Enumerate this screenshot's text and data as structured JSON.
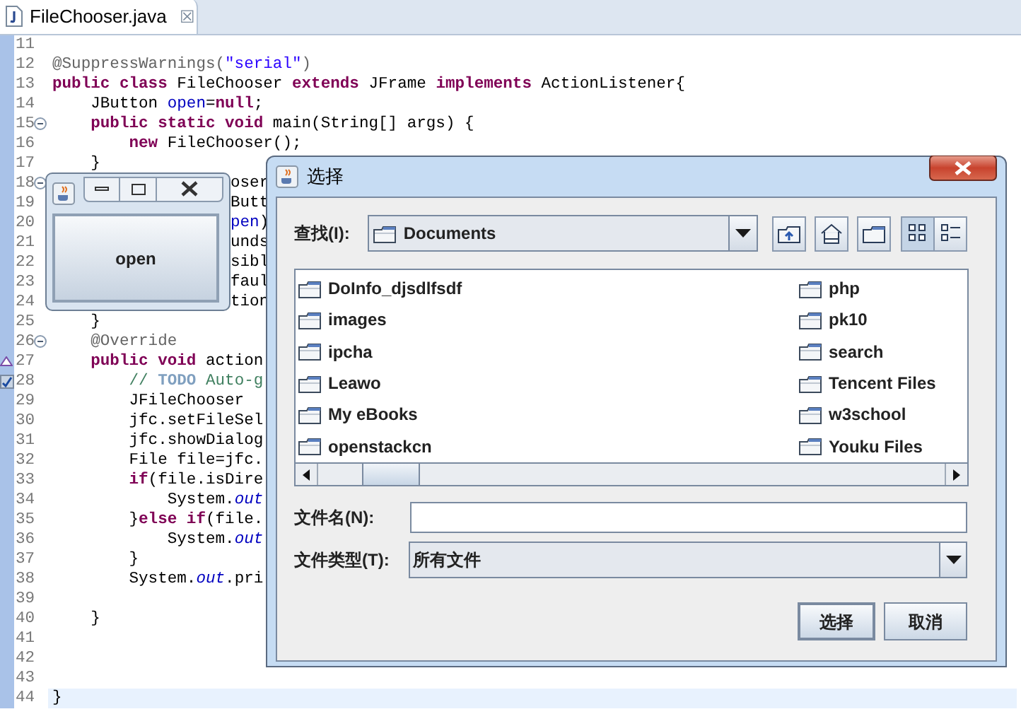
{
  "editor": {
    "tab": {
      "title": "FileChooser.java",
      "close": "☒"
    },
    "lines": [
      {
        "number": "11"
      },
      {
        "number": "12",
        "segments": [
          {
            "kind": "annotation",
            "text": "@SuppressWarnings("
          },
          {
            "kind": "string",
            "text": "\"serial\""
          },
          {
            "kind": "annotation",
            "text": ")"
          }
        ]
      },
      {
        "number": "13",
        "segments": [
          {
            "kind": "keyword",
            "text": "public class"
          },
          {
            "kind": "plain",
            "text": " FileChooser "
          },
          {
            "kind": "keyword",
            "text": "extends"
          },
          {
            "kind": "plain",
            "text": " JFrame "
          },
          {
            "kind": "keyword",
            "text": "implements"
          },
          {
            "kind": "plain",
            "text": " ActionListener{"
          }
        ]
      },
      {
        "number": "14",
        "segments": [
          {
            "kind": "plain",
            "text": "    JButton "
          },
          {
            "kind": "field",
            "text": "open"
          },
          {
            "kind": "plain",
            "text": "="
          },
          {
            "kind": "keyword",
            "text": "null"
          },
          {
            "kind": "plain",
            "text": ";"
          }
        ]
      },
      {
        "number": "15",
        "marker": {
          "kind": "fold"
        },
        "segments": [
          {
            "kind": "keyword",
            "text": "    public static void"
          },
          {
            "kind": "plain",
            "text": " main(String[] args) {"
          }
        ]
      },
      {
        "number": "16",
        "segments": [
          {
            "kind": "keyword",
            "text": "        new"
          },
          {
            "kind": "plain",
            "text": " FileChooser();"
          }
        ]
      },
      {
        "number": "17",
        "segments": [
          {
            "kind": "plain",
            "text": "    }"
          }
        ]
      },
      {
        "number": "18",
        "marker": {
          "kind": "fold"
        },
        "clipped": true,
        "segments": [
          {
            "kind": "plain",
            "text": "oser"
          }
        ]
      },
      {
        "number": "19",
        "clipped": true,
        "segments": [
          {
            "kind": "plain",
            "text": "Butt"
          }
        ]
      },
      {
        "number": "20",
        "clipped": true,
        "segments": [
          {
            "kind": "field",
            "text": "pen"
          },
          {
            "kind": "plain",
            "text": ")"
          }
        ]
      },
      {
        "number": "21",
        "clipped": true,
        "segments": [
          {
            "kind": "plain",
            "text": "unds"
          }
        ]
      },
      {
        "number": "22",
        "clipped": true,
        "segments": [
          {
            "kind": "plain",
            "text": "sibl"
          }
        ]
      },
      {
        "number": "23",
        "clipped": true,
        "segments": [
          {
            "kind": "plain",
            "text": "faul"
          }
        ]
      },
      {
        "number": "24",
        "clipped": true,
        "segments": [
          {
            "kind": "plain",
            "text": "tion"
          }
        ]
      },
      {
        "number": "25",
        "segments": [
          {
            "kind": "plain",
            "text": "    }"
          }
        ]
      },
      {
        "number": "26",
        "marker": {
          "kind": "fold"
        },
        "segments": [
          {
            "kind": "annotation",
            "text": "    @Override"
          }
        ]
      },
      {
        "number": "27",
        "marker": {
          "kind": "override"
        },
        "segments": [
          {
            "kind": "keyword",
            "text": "    public void"
          },
          {
            "kind": "plain",
            "text": " action"
          }
        ]
      },
      {
        "number": "28",
        "marker": {
          "kind": "task"
        },
        "segments": [
          {
            "kind": "comment",
            "text": "        // "
          },
          {
            "kind": "todo",
            "text": "TODO"
          },
          {
            "kind": "comment",
            "text": " Auto-g"
          }
        ]
      },
      {
        "number": "29",
        "segments": [
          {
            "kind": "plain",
            "text": "        JFileChooser"
          }
        ]
      },
      {
        "number": "30",
        "segments": [
          {
            "kind": "plain",
            "text": "        jfc.setFileSel"
          }
        ]
      },
      {
        "number": "31",
        "segments": [
          {
            "kind": "plain",
            "text": "        jfc.showDialog"
          }
        ]
      },
      {
        "number": "32",
        "segments": [
          {
            "kind": "plain",
            "text": "        File file=jfc."
          }
        ]
      },
      {
        "number": "33",
        "segments": [
          {
            "kind": "keyword",
            "text": "        if"
          },
          {
            "kind": "plain",
            "text": "(file.isDire"
          }
        ]
      },
      {
        "number": "34",
        "segments": [
          {
            "kind": "plain",
            "text": "            System."
          },
          {
            "kind": "static",
            "text": "out"
          }
        ]
      },
      {
        "number": "35",
        "segments": [
          {
            "kind": "plain",
            "text": "        }"
          },
          {
            "kind": "keyword",
            "text": "else if"
          },
          {
            "kind": "plain",
            "text": "(file."
          }
        ]
      },
      {
        "number": "36",
        "segments": [
          {
            "kind": "plain",
            "text": "            System."
          },
          {
            "kind": "static",
            "text": "out"
          }
        ]
      },
      {
        "number": "37",
        "segments": [
          {
            "kind": "plain",
            "text": "        }"
          }
        ]
      },
      {
        "number": "38",
        "segments": [
          {
            "kind": "plain",
            "text": "        System."
          },
          {
            "kind": "static",
            "text": "out"
          },
          {
            "kind": "plain",
            "text": ".pri"
          }
        ]
      },
      {
        "number": "39"
      },
      {
        "number": "40",
        "segments": [
          {
            "kind": "plain",
            "text": "    }"
          }
        ]
      },
      {
        "number": "41"
      },
      {
        "number": "42"
      },
      {
        "number": "43"
      },
      {
        "number": "44",
        "current": true,
        "segments": [
          {
            "kind": "plain",
            "text": "}"
          }
        ]
      }
    ]
  },
  "small_window": {
    "button": "open"
  },
  "dialog": {
    "title": "选择",
    "look_in": {
      "label": "查找(I):",
      "value": "Documents"
    },
    "toolbar": [
      {
        "kind": "up",
        "selected": false
      },
      {
        "kind": "home",
        "selected": false
      },
      {
        "kind": "new_folder",
        "selected": false
      },
      {
        "kind": "list",
        "selected": true
      },
      {
        "kind": "details",
        "selected": false
      }
    ],
    "files": [
      {
        "name": "DoInfo_djsdlfsdf"
      },
      {
        "name": "images"
      },
      {
        "name": "ipcha"
      },
      {
        "name": "Leawo"
      },
      {
        "name": "My eBooks"
      },
      {
        "name": "openstackcn"
      },
      {
        "name": "php"
      },
      {
        "name": "pk10"
      },
      {
        "name": "search"
      },
      {
        "name": "Tencent Files"
      },
      {
        "name": "w3school"
      },
      {
        "name": "Youku Files"
      }
    ],
    "file_name": {
      "label": "文件名(N):"
    },
    "file_type": {
      "label": "文件类型(T):",
      "value": "所有文件"
    },
    "buttons": [
      "选择",
      "取消"
    ]
  }
}
